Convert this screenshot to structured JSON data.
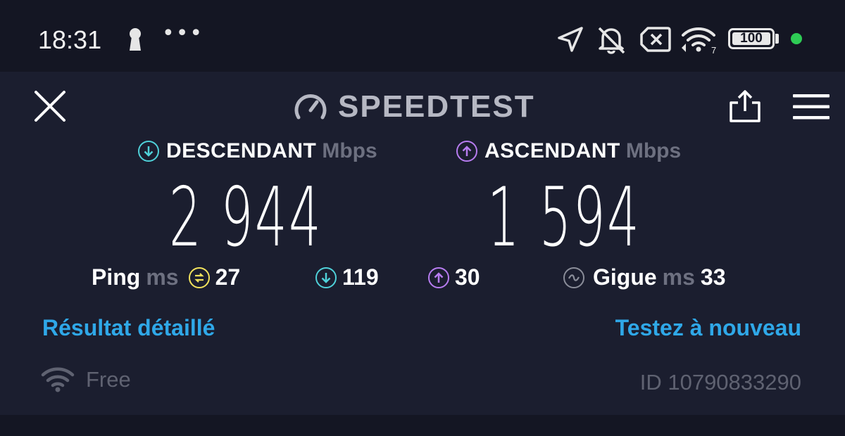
{
  "status_bar": {
    "time": "18:31",
    "more_dots": "•••",
    "battery_level": "100",
    "icons": [
      "keyhole-icon",
      "navigation-icon",
      "bell-off-icon",
      "sim-x-icon",
      "wifi-7-icon",
      "battery-icon",
      "status-dot"
    ],
    "dot_color": "#2ecc55",
    "wifi_badge": "7"
  },
  "header": {
    "brand": "SPEEDTEST",
    "close_icon": "close-icon",
    "share_icon": "share-icon",
    "menu_icon": "menu-icon"
  },
  "download": {
    "label": "DESCENDANT",
    "unit": "Mbps",
    "value": "2 944",
    "icon": "download-arrow-icon",
    "color": "#4fd1d9"
  },
  "upload": {
    "label": "ASCENDANT",
    "unit": "Mbps",
    "value": "1 594",
    "icon": "upload-arrow-icon",
    "color": "#b77cf0"
  },
  "ping": {
    "label": "Ping",
    "unit": "ms",
    "idle": "27",
    "idle_color": "#f2e25c",
    "download": "119",
    "upload": "30"
  },
  "jitter": {
    "label": "Gigue",
    "unit": "ms",
    "value": "33"
  },
  "links": {
    "detailed_result": "Résultat détaillé",
    "test_again": "Testez à nouveau",
    "color": "#2fa8e8"
  },
  "footer": {
    "network_name": "Free",
    "result_id": "ID 10790833290"
  }
}
